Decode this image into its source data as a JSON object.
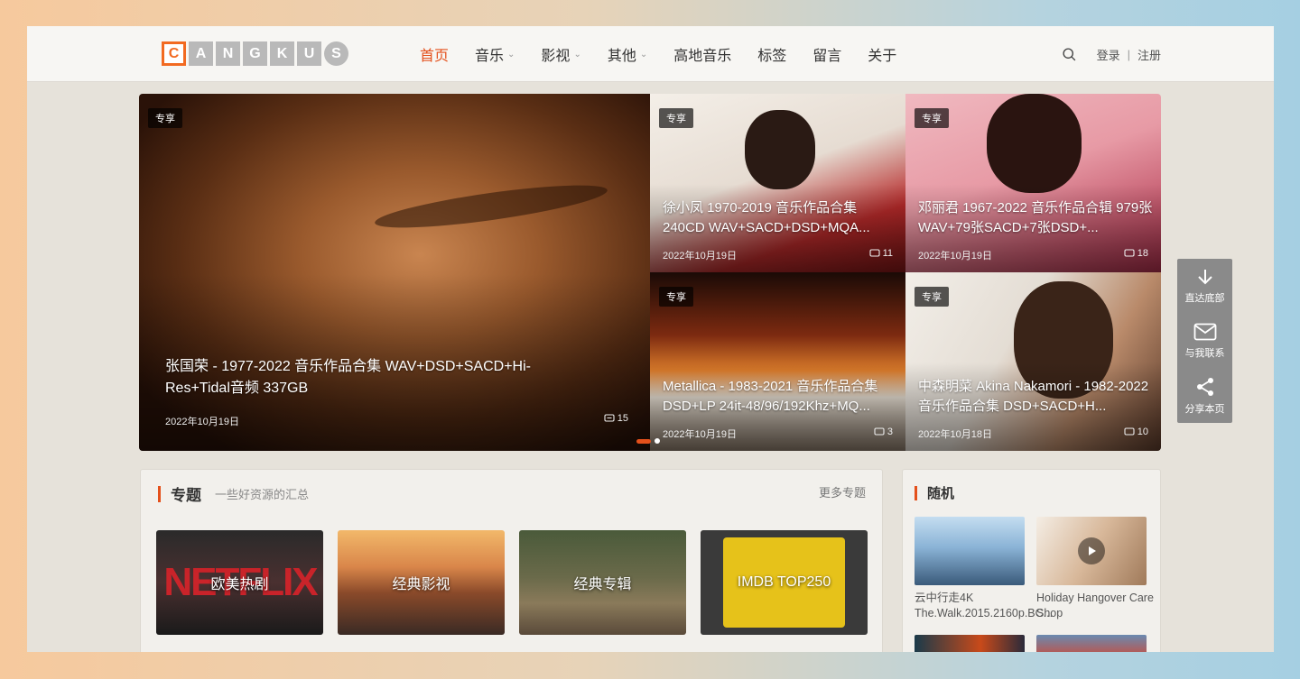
{
  "header": {
    "logo_letters": [
      "C",
      "A",
      "N",
      "G",
      "K",
      "U",
      "S"
    ],
    "nav": [
      {
        "label": "首页",
        "active": true,
        "dropdown": false
      },
      {
        "label": "音乐",
        "active": false,
        "dropdown": true
      },
      {
        "label": "影视",
        "active": false,
        "dropdown": true
      },
      {
        "label": "其他",
        "active": false,
        "dropdown": true
      },
      {
        "label": "高地音乐",
        "active": false,
        "dropdown": false
      },
      {
        "label": "标签",
        "active": false,
        "dropdown": false
      },
      {
        "label": "留言",
        "active": false,
        "dropdown": false
      },
      {
        "label": "关于",
        "active": false,
        "dropdown": false
      }
    ],
    "login": "登录",
    "divider": "|",
    "register": "注册"
  },
  "slider": {
    "main": {
      "tag": "专享",
      "title": "张国荣 - 1977-2022 音乐作品合集 WAV+DSD+SACD+Hi-Res+Tidal音频 337GB",
      "date": "2022年10月19日",
      "comments": "15"
    },
    "tiles": [
      {
        "tag": "专享",
        "title": "徐小凤 1970-2019 音乐作品合集 240CD WAV+SACD+DSD+MQA...",
        "date": "2022年10月19日",
        "comments": "11"
      },
      {
        "tag": "专享",
        "title": "邓丽君 1967-2022 音乐作品合辑 979张WAV+79张SACD+7张DSD+...",
        "date": "2022年10月19日",
        "comments": "18"
      },
      {
        "tag": "专享",
        "title": "Metallica - 1983-2021 音乐作品合集 DSD+LP 24it-48/96/192Khz+MQ...",
        "date": "2022年10月19日",
        "comments": "3"
      },
      {
        "tag": "专享",
        "title": "中森明菜 Akina Nakamori - 1982-2022 音乐作品合集 DSD+SACD+H...",
        "date": "2022年10月18日",
        "comments": "10"
      }
    ]
  },
  "topics": {
    "title": "专题",
    "subtitle": "一些好资源的汇总",
    "more": "更多专题",
    "items": [
      {
        "label": "欧美热剧"
      },
      {
        "label": "经典影视"
      },
      {
        "label": "经典专辑"
      },
      {
        "label": "IMDB TOP250"
      }
    ]
  },
  "random": {
    "title": "随机",
    "items": [
      {
        "caption": "云中行走4K The.Walk.2015.2160p.BC..."
      },
      {
        "caption": "Holiday Hangover Care Shop"
      }
    ]
  },
  "float_bar": [
    {
      "label": "直达底部",
      "icon": "arrow-down-icon"
    },
    {
      "label": "与我联系",
      "icon": "mail-icon"
    },
    {
      "label": "分享本页",
      "icon": "share-icon"
    }
  ],
  "colors": {
    "accent": "#e4501b",
    "logo_orange": "#f26a21"
  }
}
